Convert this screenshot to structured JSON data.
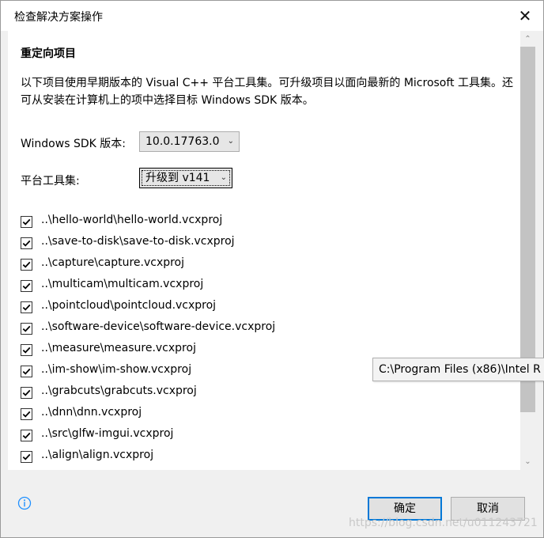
{
  "window": {
    "title": "检查解决方案操作"
  },
  "section": {
    "heading": "重定向项目",
    "description": "以下项目使用早期版本的 Visual C++ 平台工具集。可升级项目以面向最新的 Microsoft 工具集。还可从安装在计算机上的项中选择目标 Windows SDK 版本。"
  },
  "sdk": {
    "label": "Windows SDK 版本:",
    "value": "10.0.17763.0"
  },
  "toolset": {
    "label": "平台工具集:",
    "value": "升级到 v141"
  },
  "projects": [
    {
      "label": "..\\hello-world\\hello-world.vcxproj",
      "checked": true
    },
    {
      "label": "..\\save-to-disk\\save-to-disk.vcxproj",
      "checked": true
    },
    {
      "label": "..\\capture\\capture.vcxproj",
      "checked": true
    },
    {
      "label": "..\\multicam\\multicam.vcxproj",
      "checked": true
    },
    {
      "label": "..\\pointcloud\\pointcloud.vcxproj",
      "checked": true
    },
    {
      "label": "..\\software-device\\software-device.vcxproj",
      "checked": true
    },
    {
      "label": "..\\measure\\measure.vcxproj",
      "checked": true
    },
    {
      "label": "..\\im-show\\im-show.vcxproj",
      "checked": true
    },
    {
      "label": "..\\grabcuts\\grabcuts.vcxproj",
      "checked": true
    },
    {
      "label": "..\\dnn\\dnn.vcxproj",
      "checked": true
    },
    {
      "label": "..\\src\\glfw-imgui.vcxproj",
      "checked": true
    },
    {
      "label": "..\\align\\align.vcxproj",
      "checked": true
    }
  ],
  "tooltip": "C:\\Program Files (x86)\\Intel R",
  "buttons": {
    "ok": "确定",
    "cancel": "取消"
  },
  "watermark": "https://blog.csdn.net/u011243721",
  "colors": {
    "accent": "#0078d7",
    "info_icon": "#1e90ff"
  }
}
